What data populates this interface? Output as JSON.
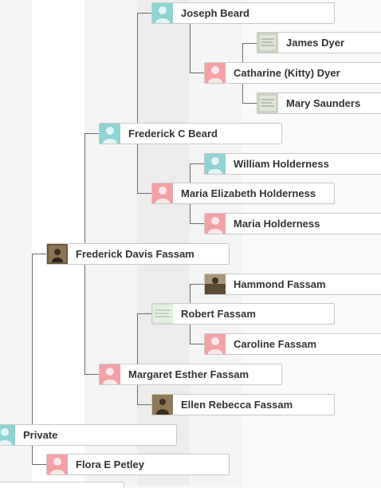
{
  "tree": {
    "people": {
      "joseph_beard": {
        "name": "Joseph Beard",
        "avatar": "male-silhouette-icon"
      },
      "james_dyer": {
        "name": "James Dyer",
        "avatar": "document-photo"
      },
      "catharine_dyer": {
        "name": "Catharine (Kitty) Dyer",
        "avatar": "female-silhouette-icon"
      },
      "mary_saunders": {
        "name": "Mary Saunders",
        "avatar": "document-photo"
      },
      "frederick_c_beard": {
        "name": "Frederick C Beard",
        "avatar": "male-silhouette-icon"
      },
      "william_holderness": {
        "name": "William Holderness",
        "avatar": "male-silhouette-icon"
      },
      "maria_elizabeth_holderness": {
        "name": "Maria Elizabeth Holderness",
        "avatar": "female-silhouette-icon"
      },
      "maria_holderness": {
        "name": "Maria Holderness",
        "avatar": "female-silhouette-icon"
      },
      "frederick_davis_fassam": {
        "name": "Frederick Davis Fassam",
        "avatar": "portrait-photo"
      },
      "hammond_fassam": {
        "name": "Hammond Fassam",
        "avatar": "portrait-photo"
      },
      "robert_fassam": {
        "name": "Robert Fassam",
        "avatar": "document-photo"
      },
      "caroline_fassam": {
        "name": "Caroline Fassam",
        "avatar": "female-silhouette-icon"
      },
      "margaret_esther_fassam": {
        "name": "Margaret Esther Fassam",
        "avatar": "female-silhouette-icon"
      },
      "ellen_rebecca_fassam": {
        "name": "Ellen Rebecca Fassam",
        "avatar": "portrait-photo"
      },
      "private": {
        "name": "Private",
        "avatar": "male-silhouette-icon"
      },
      "flora_e_petley": {
        "name": "Flora E Petley",
        "avatar": "female-silhouette-icon"
      }
    }
  },
  "colors": {
    "male_avatar": "#8fd3d3",
    "female_avatar": "#f3a1a6",
    "connector": "#6b6b6b",
    "card_border": "#c9c9c9"
  }
}
